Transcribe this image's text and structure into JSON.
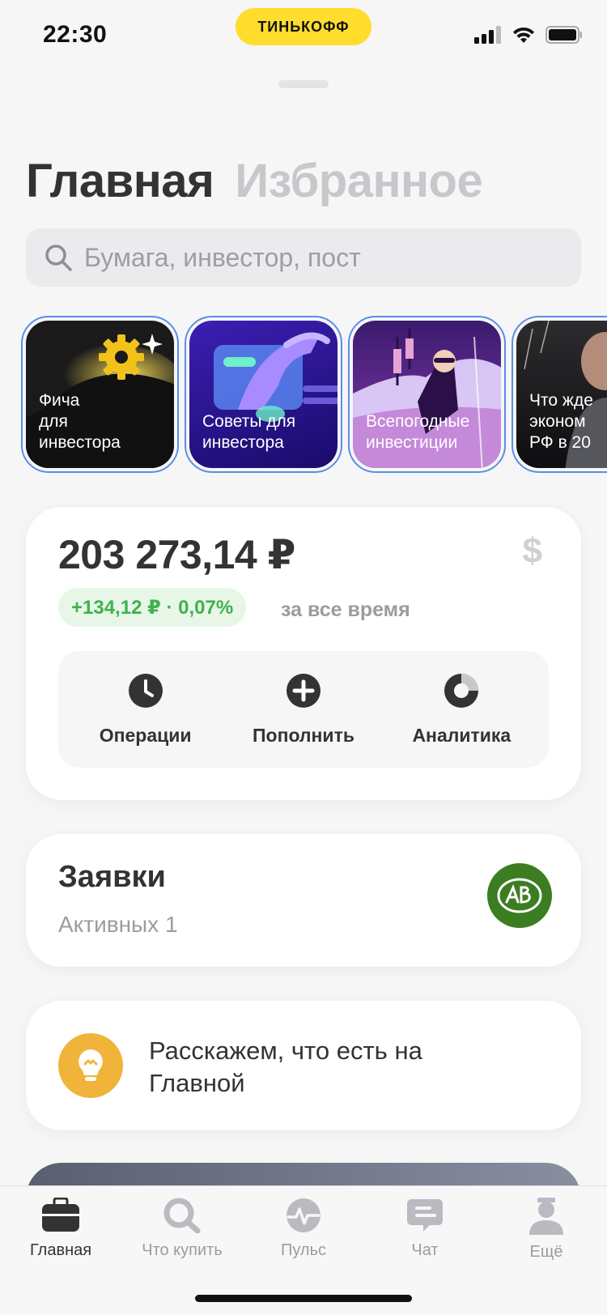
{
  "status_bar": {
    "time": "22:30",
    "bank_badge": "ТИНЬКОФФ",
    "icons": [
      "signal-icon",
      "wifi-icon",
      "battery-icon"
    ]
  },
  "tabs": [
    {
      "label": "Главная",
      "active": true
    },
    {
      "label": "Избранное",
      "active": false
    }
  ],
  "search": {
    "placeholder": "Бумага, инвестор, пост",
    "value": ""
  },
  "stories": [
    {
      "label": "Фича\nдля\nинвестора",
      "icon": "gear-sparkle-icon"
    },
    {
      "label": "Советы для\nинвестора",
      "icon": "hand-card-icon"
    },
    {
      "label": "Всепогодные\nинвестиции",
      "icon": "man-umbrella-icon"
    },
    {
      "label": "Что жде\nэконом\nРФ в 20",
      "icon": "person-photo-icon"
    }
  ],
  "portfolio": {
    "amount": "203 273,14 ₽",
    "currency_toggle": "$",
    "profit": "+134,12 ₽ · 0,07%",
    "profit_caption": "за все время",
    "actions": [
      {
        "label": "Операции",
        "icon": "clock-icon"
      },
      {
        "label": "Пополнить",
        "icon": "plus-icon"
      },
      {
        "label": "Аналитика",
        "icon": "pie-chart-icon"
      }
    ]
  },
  "orders": {
    "title": "Заявки",
    "subtitle": "Активных 1"
  },
  "hint": {
    "text": "Расскажем, что есть на Главной",
    "icon": "lightbulb-icon"
  },
  "tabbar": [
    {
      "label": "Главная",
      "icon": "briefcase-icon",
      "active": true
    },
    {
      "label": "Что купить",
      "icon": "search-icon",
      "active": false
    },
    {
      "label": "Пульс",
      "icon": "pulse-icon",
      "active": false
    },
    {
      "label": "Чат",
      "icon": "chat-icon",
      "active": false
    },
    {
      "label": "Ещё",
      "icon": "profile-icon",
      "active": false
    }
  ],
  "colors": {
    "accent_yellow": "#ffdd2d",
    "profit_green": "#3fb24e",
    "story_border": "#5a8ee6"
  }
}
